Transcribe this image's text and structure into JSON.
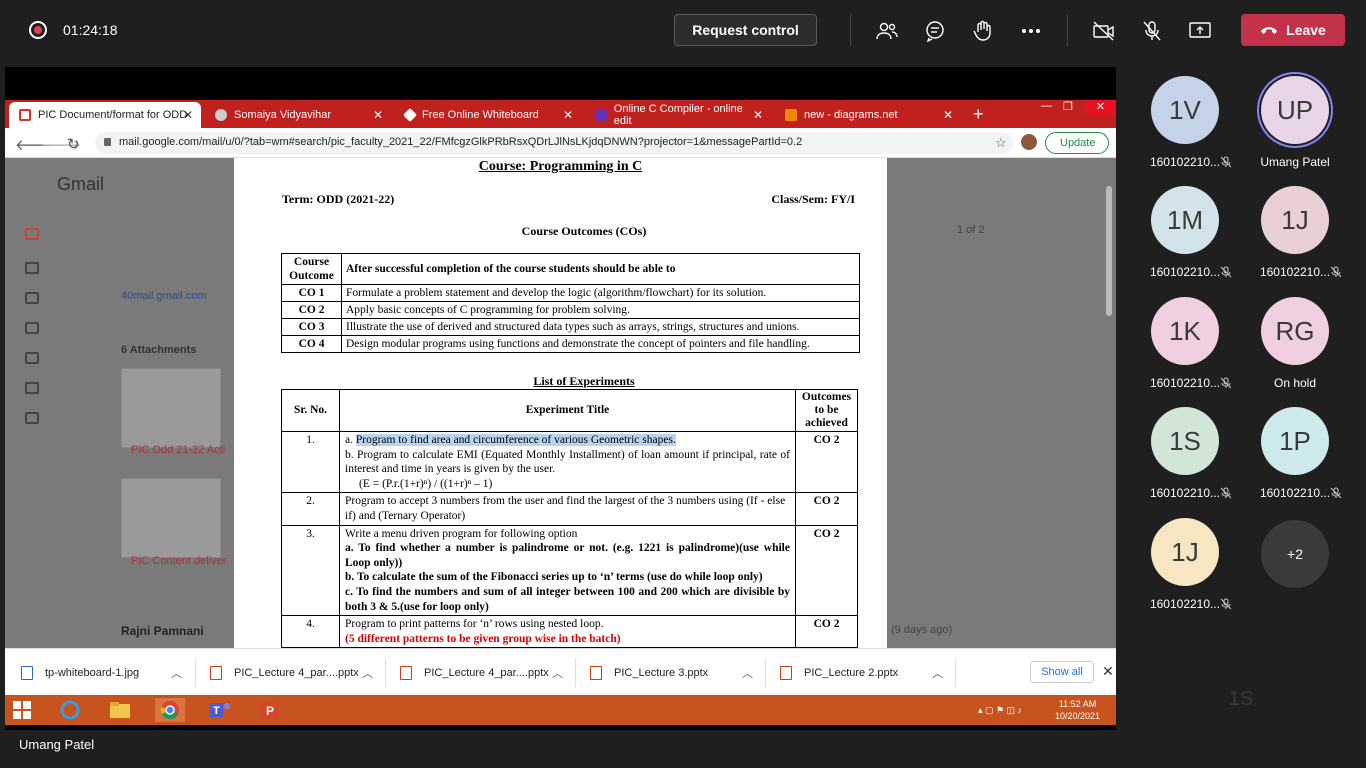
{
  "meeting": {
    "timer": "01:24:18",
    "request_control": "Request control",
    "leave": "Leave",
    "presenter": "Umang Patel"
  },
  "browser": {
    "tabs": [
      {
        "label": "PIC Document/format for ODD",
        "active": true
      },
      {
        "label": "Somaiya Vidyavihar"
      },
      {
        "label": "Free Online Whiteboard"
      },
      {
        "label": "Online C Compiler - online edit"
      },
      {
        "label": "new - diagrams.net"
      }
    ],
    "url": "mail.google.com/mail/u/0/?tab=wm#search/pic_faculty_2021_22/FMfcgzGlkPRbRsxQDrLJlNsLKjdqDNWN?projector=1&messagePartId=0.2",
    "update": "Update"
  },
  "gmail": {
    "title": "Gmail",
    "attachments": "6 Attachments",
    "email_fragment": "40mail.gmail.com",
    "sender": "Rajni Pamnani",
    "pager": "1 of 2",
    "file1": "PIC Odd 21-22 Acti",
    "file2": "PIC Content deliver",
    "ago": "(9 days ago)"
  },
  "document": {
    "course_title": "Course: Programming in C",
    "term": "Term: ODD (2021-22)",
    "class_sem": "Class/Sem: FY/I",
    "co_heading": "Course Outcomes (COs)",
    "co_header": [
      "Course Outcome",
      "After successful  completion of the course students should be able to"
    ],
    "cos": [
      {
        "id": "CO 1",
        "text": "Formulate a problem statement and develop the logic (algorithm/flowchart) for its solution."
      },
      {
        "id": "CO 2",
        "text": "Apply basic concepts of C programming for problem solving."
      },
      {
        "id": "CO 3",
        "text": "Illustrate the use of derived and structured data types such as arrays, strings, structures and unions."
      },
      {
        "id": "CO 4",
        "text": "Design modular programs using functions and demonstrate the concept of pointers and file handling."
      }
    ],
    "exp_heading": "List of Experiments",
    "exp_header": [
      "Sr. No.",
      "Experiment Title",
      "Outcomes to be achieved"
    ],
    "exp1": {
      "sr": "1.",
      "a_prefix": "a.",
      "a": "Program to find area and circumference of various Geometric shapes.",
      "b_prefix": "b.",
      "b": "Program to calculate EMI (Equated Monthly Installment) of loan amount if principal, rate of interest and time in years is given by the user.",
      "formula": "(E = (P.r.(1+r)ⁿ) / ((1+r)ⁿ – 1)",
      "co": "CO 2"
    },
    "exp2": {
      "sr": "2.",
      "text": "Program to accept 3 numbers from the user and find the largest of the 3 numbers using (If - else if) and (Ternary Operator)",
      "co": "CO 2"
    },
    "exp3": {
      "sr": "3.",
      "intro": "Write a menu driven program for following option",
      "a": "a. To find whether a number is palindrome or not. (e.g. 1221 is palindrome)(use while Loop only))",
      "b": "b. To calculate the sum of the Fibonacci series up to ‘n’ terms (use do while loop only)",
      "c": "c. To find the numbers and sum of all integer between 100 and 200 which are divisible by both 3 & 5.(use for loop only)",
      "co": "CO 2"
    },
    "exp4": {
      "sr": "4.",
      "text": "Program to print patterns for ‘n’ rows using nested loop.",
      "note": "(5 different patterns to be given group wise in the batch)",
      "co": "CO 2"
    }
  },
  "downloads": {
    "items": [
      "tp-whiteboard-1.jpg",
      "PIC_Lecture 4_par....pptx",
      "PIC_Lecture 4_par....pptx",
      "PIC_Lecture 3.pptx",
      "PIC_Lecture 2.pptx"
    ],
    "show_all": "Show all"
  },
  "taskbar": {
    "time": "11:52 AM",
    "date": "10/20/2021"
  },
  "participants": [
    {
      "initials": "1V",
      "name": "160102210...",
      "color": "#c5d3e8",
      "muted": true
    },
    {
      "initials": "UP",
      "name": "Umang Patel",
      "color": "#e8d5ea",
      "muted": false
    },
    {
      "initials": "1M",
      "name": "160102210...",
      "color": "#d3e3ea",
      "muted": true
    },
    {
      "initials": "1J",
      "name": "160102210...",
      "color": "#e8d0d5",
      "muted": true
    },
    {
      "initials": "1K",
      "name": "160102210...",
      "color": "#f0cfe0",
      "muted": true
    },
    {
      "initials": "RG",
      "name": "On hold",
      "color": "#f0cfe0",
      "muted": false
    },
    {
      "initials": "1S",
      "name": "160102210...",
      "color": "#d2e6d8",
      "muted": true
    },
    {
      "initials": "1P",
      "name": "160102210...",
      "color": "#cde9ec",
      "muted": true
    },
    {
      "initials": "1J",
      "name": "160102210...",
      "color": "#f6e6c2",
      "muted": true
    }
  ],
  "overflow": "+2",
  "self": {
    "initials": "1S",
    "color": "#f0cfe0"
  }
}
